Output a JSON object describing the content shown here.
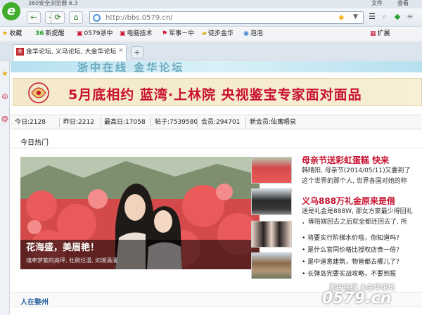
{
  "browser": {
    "title": "360安全浏览器 6.3",
    "menu": [
      "文件",
      "查看"
    ],
    "url": "http://bbs.0579.cn/",
    "logo": "e"
  },
  "bookmarks": [
    {
      "icon": "star-icon",
      "label": "收藏"
    },
    {
      "icon": "360-icon",
      "label": "新提醒"
    },
    {
      "icon": "page-icon",
      "label": "0579浙中"
    },
    {
      "icon": "page-icon",
      "label": "电脑技术"
    },
    {
      "icon": "flag-icon",
      "label": "军事－中"
    },
    {
      "icon": "folder-icon",
      "label": "徒步金华"
    },
    {
      "icon": "page-icon",
      "label": "泡泡"
    },
    {
      "icon": "grid-icon",
      "label": "扩展"
    }
  ],
  "tab": {
    "title": "金华论坛, 义乌论坛, 大金华论坛",
    "close": "×",
    "new": "+"
  },
  "banner": {
    "text": "5月底相约  蓝湾·上林院  央视鉴宝专家面对面品",
    "top_faded": "浙中在线 金华论坛"
  },
  "stats": [
    {
      "label": "今日:",
      "value": "2128"
    },
    {
      "label": "昨日:",
      "value": "2212"
    },
    {
      "label": "最高日:",
      "value": "17058"
    },
    {
      "label": "帖子:",
      "value": "7539580"
    },
    {
      "label": "会员:",
      "value": "294701"
    },
    {
      "label": "新会员:",
      "value": "仙寓晤泉"
    }
  ],
  "hot": {
    "title": "今日热门"
  },
  "feature": {
    "caption": "花海盛，美眉艳！",
    "sub": "魂牵梦萦的高坪, 杜鹃烂漫, 如潮涌涌"
  },
  "right": {
    "h1": "母亲节送彩虹蛋糕 快来",
    "s1a": "韩晴阳, 母亲节(2014/05/11)又要到了",
    "s1b": "这个世界的那个人, 世界各国对她的称",
    "h2": "义乌888万礼金原来是借",
    "s2a": "送是礼金是888W, 那女方家最少得回礼",
    "s2b": "，等陪嫁回去之后就全都还回去了, 所",
    "list": [
      "将要实行阶梯水价啦，你知道吗?",
      "是什么官同价格比授权店贵一倍?",
      "是中道意建筑，物管都去哪儿了?",
      "长弹岛完要实战攻略，不要到报"
    ]
  },
  "section2": {
    "title": "人在婺州"
  },
  "watermark": {
    "line1": "浙中在线 大金华论坛",
    "line2": "0579.cn"
  }
}
